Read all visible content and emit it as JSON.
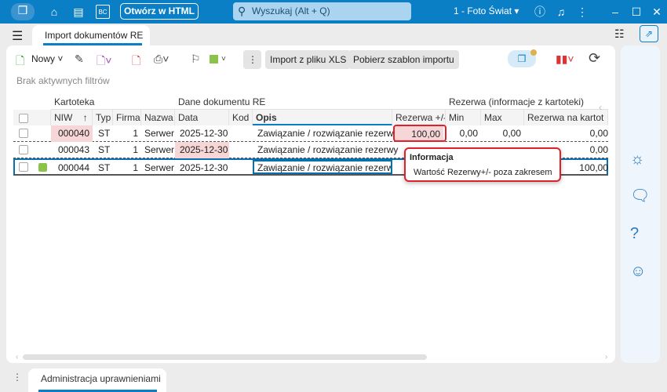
{
  "titlebar": {
    "open_html": "Otwórz w HTML",
    "search_placeholder": "Wyszukaj (Alt + Q)",
    "company": "1 - Foto Świat",
    "bc": "BC"
  },
  "tab": "Import dokumentów RE",
  "toolbar": {
    "new": "Nowy",
    "import_xls": "Import z pliku XLS",
    "download_template": "Pobierz szablon importu",
    "more": "⋮"
  },
  "filters": "Brak aktywnych filtrów",
  "grid": {
    "groups": [
      "Kartoteka",
      "Dane dokumentu RE",
      "Rezerwa (informacje z kartoteki)"
    ],
    "columns": [
      "NIW",
      "Typ",
      "Firma",
      "Nazwa",
      "Data",
      "Kod",
      "Opis",
      "Rezerwa +/-",
      "Min",
      "Max",
      "Rezerwa na kartot"
    ],
    "sort_arrow": "↑",
    "rows": [
      {
        "niw": "000040",
        "typ": "ST",
        "firma": "1",
        "nazwa": "Serwer",
        "data": "2025-12-30",
        "kod": "",
        "opis": "Zawiązanie / rozwiązanie rezerwy",
        "rez": "100,00",
        "min": "0,00",
        "max": "0,00",
        "kart": "0,00"
      },
      {
        "niw": "000043",
        "typ": "ST",
        "firma": "1",
        "nazwa": "Serwer",
        "data": "2025-12-30",
        "kod": "",
        "opis": "Zawiązanie / rozwiązanie rezerwy",
        "rez": "",
        "min": "",
        "max": "",
        "kart": "0,00"
      },
      {
        "niw": "000044",
        "typ": "ST",
        "firma": "1",
        "nazwa": "Serwer",
        "data": "2025-12-30",
        "kod": "",
        "opis": "Zawiązanie / rozwiązanie rezerwy",
        "rez": "",
        "min": "",
        "max": "",
        "kart": "100,00"
      }
    ]
  },
  "tooltip": {
    "title": "Informacja",
    "message": "Wartość Rezerwy+/- poza zakresem"
  },
  "bottom_tab": "Administracja uprawnieniami",
  "colors": {
    "accent": "#0a7fc6",
    "error": "#e0202a",
    "flag": "#8bc34a"
  }
}
